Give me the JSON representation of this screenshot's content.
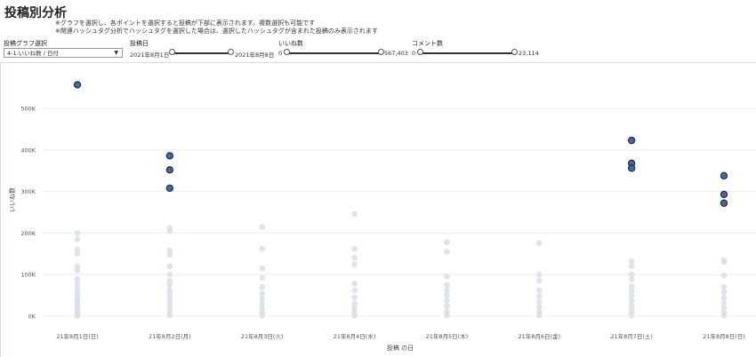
{
  "title": "投稿別分析",
  "notes": [
    "※グラフを選択し、各ポイントを選択すると投稿が下部に表示されます。複数選択も可能です",
    "※関連ハッシュタグ分析でハッシュタグを選択した場合は、選択したハッシュタグが含まれた投稿のみ表示されます"
  ],
  "filters": {
    "graph_select": {
      "label": "投稿グラフ選択",
      "value": "4-1.いいね数 / 日付"
    },
    "post_date": {
      "label": "投稿日",
      "min": "2021年8月1日",
      "max": "2021年8月8日"
    },
    "likes": {
      "label": "いいね数",
      "min": "0",
      "max": "567,403"
    },
    "comments": {
      "label": "コメント数",
      "min": "0",
      "max": "23,114"
    }
  },
  "chart_data": {
    "type": "scatter",
    "xlabel": "投稿 の日",
    "ylabel": "いいね数",
    "categories": [
      "21年8月1日(日)",
      "21年8月2日(月)",
      "21年8月3日(火)",
      "21年8月4日(水)",
      "21年8月5日(木)",
      "21年8月6日(金)",
      "21年8月7日(土)",
      "21年8月8日(日)"
    ],
    "ylim": [
      -30000,
      590000
    ],
    "yticks": [
      0,
      100000,
      200000,
      300000,
      400000,
      500000
    ],
    "ytick_labels": [
      "0K",
      "100K",
      "200K",
      "300K",
      "400K",
      "500K"
    ],
    "grid": true,
    "colors": {
      "highlight": "#4a6a96",
      "highlight_edge": "#1f2f47",
      "faded": "#d9dee6",
      "grid": "#eceff3"
    },
    "series": [
      {
        "values": [
          {
            "day": 0,
            "y": 557000
          },
          {
            "day": 1,
            "y": 386000
          },
          {
            "day": 1,
            "y": 352000
          },
          {
            "day": 1,
            "y": 308000
          },
          {
            "day": 6,
            "y": 423000
          },
          {
            "day": 6,
            "y": 368000
          },
          {
            "day": 6,
            "y": 356000
          },
          {
            "day": 7,
            "y": 338000
          },
          {
            "day": 7,
            "y": 293000
          },
          {
            "day": 7,
            "y": 272000
          }
        ]
      },
      {
        "values": [
          {
            "day": 0,
            "y": 200000
          },
          {
            "day": 0,
            "y": 185000
          },
          {
            "day": 0,
            "y": 160000
          },
          {
            "day": 0,
            "y": 150000
          },
          {
            "day": 0,
            "y": 120000
          },
          {
            "day": 0,
            "y": 110000
          },
          {
            "day": 0,
            "y": 90000
          },
          {
            "day": 0,
            "y": 80000
          },
          {
            "day": 0,
            "y": 70000
          },
          {
            "day": 0,
            "y": 60000
          },
          {
            "day": 0,
            "y": 50000
          },
          {
            "day": 0,
            "y": 42000
          },
          {
            "day": 0,
            "y": 35000
          },
          {
            "day": 0,
            "y": 28000
          },
          {
            "day": 0,
            "y": 20000
          },
          {
            "day": 0,
            "y": 12000
          },
          {
            "day": 0,
            "y": 5000
          },
          {
            "day": 0,
            "y": 1000
          },
          {
            "day": 1,
            "y": 212000
          },
          {
            "day": 1,
            "y": 205000
          },
          {
            "day": 1,
            "y": 158000
          },
          {
            "day": 1,
            "y": 148000
          },
          {
            "day": 1,
            "y": 120000
          },
          {
            "day": 1,
            "y": 100000
          },
          {
            "day": 1,
            "y": 85000
          },
          {
            "day": 1,
            "y": 75000
          },
          {
            "day": 1,
            "y": 62000
          },
          {
            "day": 1,
            "y": 50000
          },
          {
            "day": 1,
            "y": 40000
          },
          {
            "day": 1,
            "y": 30000
          },
          {
            "day": 1,
            "y": 20000
          },
          {
            "day": 1,
            "y": 10000
          },
          {
            "day": 1,
            "y": 2000
          },
          {
            "day": 2,
            "y": 215000
          },
          {
            "day": 2,
            "y": 162000
          },
          {
            "day": 2,
            "y": 115000
          },
          {
            "day": 2,
            "y": 92000
          },
          {
            "day": 2,
            "y": 70000
          },
          {
            "day": 2,
            "y": 55000
          },
          {
            "day": 2,
            "y": 42000
          },
          {
            "day": 2,
            "y": 30000
          },
          {
            "day": 2,
            "y": 18000
          },
          {
            "day": 2,
            "y": 8000
          },
          {
            "day": 2,
            "y": 1000
          },
          {
            "day": 3,
            "y": 246000
          },
          {
            "day": 3,
            "y": 162000
          },
          {
            "day": 3,
            "y": 140000
          },
          {
            "day": 3,
            "y": 124000
          },
          {
            "day": 3,
            "y": 78000
          },
          {
            "day": 3,
            "y": 62000
          },
          {
            "day": 3,
            "y": 45000
          },
          {
            "day": 3,
            "y": 30000
          },
          {
            "day": 3,
            "y": 18000
          },
          {
            "day": 3,
            "y": 8000
          },
          {
            "day": 3,
            "y": 1000
          },
          {
            "day": 4,
            "y": 178000
          },
          {
            "day": 4,
            "y": 155000
          },
          {
            "day": 4,
            "y": 95000
          },
          {
            "day": 4,
            "y": 75000
          },
          {
            "day": 4,
            "y": 62000
          },
          {
            "day": 4,
            "y": 50000
          },
          {
            "day": 4,
            "y": 38000
          },
          {
            "day": 4,
            "y": 25000
          },
          {
            "day": 4,
            "y": 12000
          },
          {
            "day": 4,
            "y": 2000
          },
          {
            "day": 5,
            "y": 176000
          },
          {
            "day": 5,
            "y": 100000
          },
          {
            "day": 5,
            "y": 85000
          },
          {
            "day": 5,
            "y": 62000
          },
          {
            "day": 5,
            "y": 48000
          },
          {
            "day": 5,
            "y": 35000
          },
          {
            "day": 5,
            "y": 22000
          },
          {
            "day": 5,
            "y": 10000
          },
          {
            "day": 5,
            "y": 2000
          },
          {
            "day": 6,
            "y": 132000
          },
          {
            "day": 6,
            "y": 120000
          },
          {
            "day": 6,
            "y": 100000
          },
          {
            "day": 6,
            "y": 88000
          },
          {
            "day": 6,
            "y": 72000
          },
          {
            "day": 6,
            "y": 60000
          },
          {
            "day": 6,
            "y": 48000
          },
          {
            "day": 6,
            "y": 36000
          },
          {
            "day": 6,
            "y": 24000
          },
          {
            "day": 6,
            "y": 12000
          },
          {
            "day": 6,
            "y": 2000
          },
          {
            "day": 7,
            "y": 135000
          },
          {
            "day": 7,
            "y": 130000
          },
          {
            "day": 7,
            "y": 98000
          },
          {
            "day": 7,
            "y": 70000
          },
          {
            "day": 7,
            "y": 58000
          },
          {
            "day": 7,
            "y": 45000
          },
          {
            "day": 7,
            "y": 32000
          },
          {
            "day": 7,
            "y": 20000
          },
          {
            "day": 7,
            "y": 8000
          },
          {
            "day": 7,
            "y": 1000
          }
        ]
      }
    ]
  }
}
